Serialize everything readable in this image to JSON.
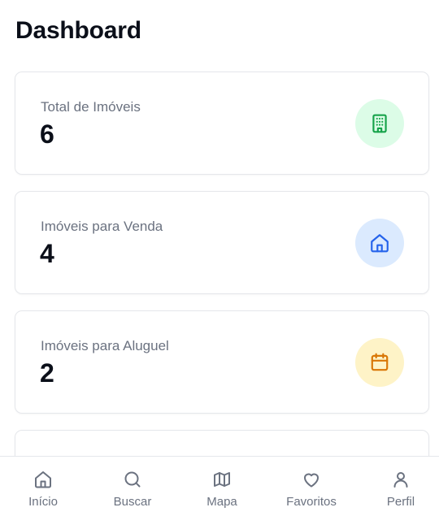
{
  "header": {
    "title": "Dashboard"
  },
  "cards": [
    {
      "label": "Total de Imóveis",
      "value": "6",
      "icon": "building-icon",
      "icon_color": "#16a34a",
      "badge_color": "#dcfce7"
    },
    {
      "label": "Imóveis para Venda",
      "value": "4",
      "icon": "home-icon",
      "icon_color": "#2563eb",
      "badge_color": "#dbeafe"
    },
    {
      "label": "Imóveis para Aluguel",
      "value": "2",
      "icon": "calendar-icon",
      "icon_color": "#d97706",
      "badge_color": "#fef3c7"
    }
  ],
  "nav": {
    "items": [
      {
        "label": "Início",
        "icon": "home-icon"
      },
      {
        "label": "Buscar",
        "icon": "search-icon"
      },
      {
        "label": "Mapa",
        "icon": "map-icon"
      },
      {
        "label": "Favoritos",
        "icon": "heart-icon"
      },
      {
        "label": "Perfil",
        "icon": "user-icon"
      }
    ]
  }
}
